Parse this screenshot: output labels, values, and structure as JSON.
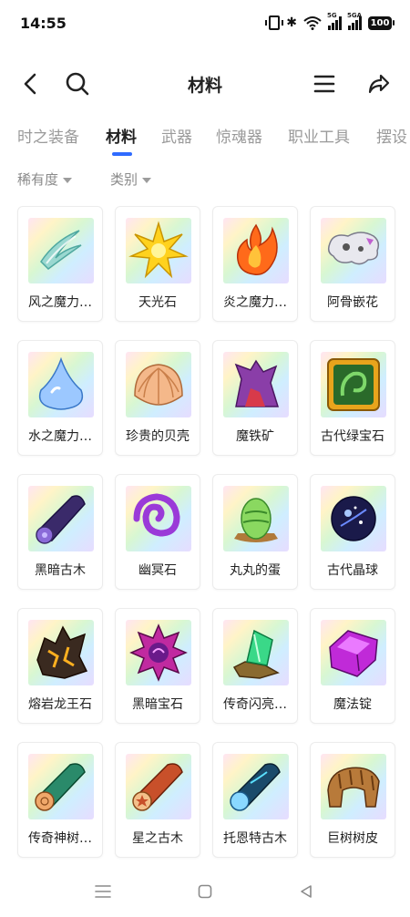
{
  "status": {
    "time": "14:55",
    "battery": "100",
    "signal1": "5G",
    "signal2": "5GA"
  },
  "header": {
    "title": "材料"
  },
  "tabs": [
    "时之装备",
    "材料",
    "武器",
    "惊魂器",
    "职业工具",
    "摆设"
  ],
  "active_tab": 1,
  "filters": {
    "rarity": "稀有度",
    "category": "类别"
  },
  "items": [
    {
      "name": "风之魔力…",
      "icon": "wind-icon"
    },
    {
      "name": "天光石",
      "icon": "star-stone-icon"
    },
    {
      "name": "炎之魔力…",
      "icon": "flame-icon"
    },
    {
      "name": "阿骨嵌花",
      "icon": "bone-icon"
    },
    {
      "name": "水之魔力…",
      "icon": "water-drop-icon"
    },
    {
      "name": "珍贵的贝壳",
      "icon": "shell-icon"
    },
    {
      "name": "魔铁矿",
      "icon": "ore-icon"
    },
    {
      "name": "古代绿宝石",
      "icon": "emerald-icon"
    },
    {
      "name": "黑暗古木",
      "icon": "dark-log-icon"
    },
    {
      "name": "幽冥石",
      "icon": "spiral-stone-icon"
    },
    {
      "name": "丸丸的蛋",
      "icon": "egg-icon"
    },
    {
      "name": "古代晶球",
      "icon": "crystal-ball-icon"
    },
    {
      "name": "熔岩龙王石",
      "icon": "lava-rock-icon"
    },
    {
      "name": "黑暗宝石",
      "icon": "dark-gem-icon"
    },
    {
      "name": "传奇闪亮…",
      "icon": "shiny-crystal-icon"
    },
    {
      "name": "魔法锭",
      "icon": "ingot-icon"
    },
    {
      "name": "传奇神树…",
      "icon": "legend-log-icon"
    },
    {
      "name": "星之古木",
      "icon": "star-log-icon"
    },
    {
      "name": "托恩特古木",
      "icon": "blue-log-icon"
    },
    {
      "name": "巨树树皮",
      "icon": "bark-icon"
    }
  ]
}
